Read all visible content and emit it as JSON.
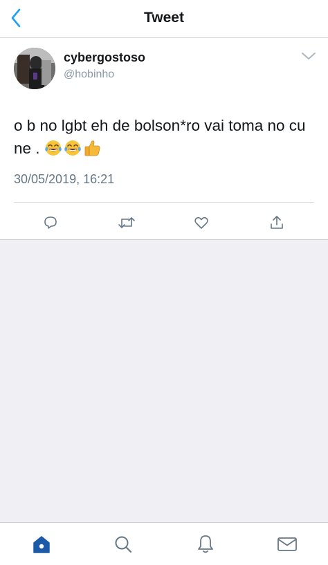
{
  "header": {
    "title": "Tweet",
    "back_icon": "chevron-left-icon"
  },
  "tweet": {
    "display_name": "cybergostoso",
    "username": "@hobinho",
    "text": "o b no lgbt eh de  bolson*ro vai toma no cu ne .",
    "emojis": [
      "face-with-tears-of-joy",
      "face-with-tears-of-joy",
      "thumbs-up"
    ],
    "timestamp": "30/05/2019, 16:21",
    "actions": [
      "reply-icon",
      "retweet-icon",
      "like-icon",
      "share-icon"
    ]
  },
  "tabbar": {
    "items": [
      "home-icon",
      "search-icon",
      "notifications-icon",
      "messages-icon"
    ],
    "active": "home-icon"
  },
  "colors": {
    "accent": "#1da1f2",
    "active_tab": "#1b5aa6",
    "secondary_text": "#657786",
    "icon_gray": "#657786",
    "background_gray": "#efeff4"
  }
}
